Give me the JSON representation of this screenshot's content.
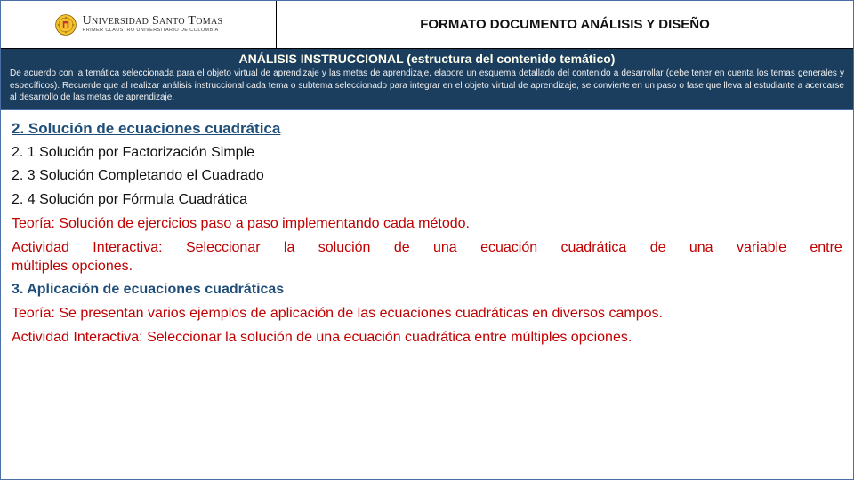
{
  "header": {
    "university_name": "Universidad Santo Tomas",
    "university_sub": "Primer claustro universitario de Colombia",
    "title": "FORMATO DOCUMENTO ANÁLISIS Y DISEÑO"
  },
  "band": {
    "title": "ANÁLISIS INSTRUCCIONAL (estructura del contenido temático)",
    "text": "De acuerdo con la temática seleccionada para el objeto virtual de aprendizaje y las metas de aprendizaje, elabore un esquema detallado del contenido a desarrollar (debe tener en cuenta los temas generales y específicos). Recuerde que al realizar análisis instruccional cada tema o subtema seleccionado para integrar en el objeto virtual de aprendizaje, se convierte en un paso o fase que lleva al estudiante a acercarse al desarrollo de las metas de aprendizaje."
  },
  "content": {
    "section2_title": "2. Solución de ecuaciones cuadrática",
    "items": {
      "a": "2. 1 Solución por Factorización Simple",
      "b": "2. 3 Solución Completando el Cuadrado",
      "c": "2. 4 Solución por Fórmula Cuadrática"
    },
    "theory2": "Teoría: Solución de ejercicios paso a paso implementando cada método.",
    "activity2_words": [
      "Actividad",
      "Interactiva:",
      "Seleccionar",
      "la",
      "solución",
      "de",
      "una",
      "ecuación",
      "cuadrática",
      "de",
      "una",
      "variable",
      "entre"
    ],
    "activity2_line2": "múltiples opciones.",
    "section3_title": "3. Aplicación de ecuaciones cuadráticas",
    "theory3": "Teoría: Se presentan varios ejemplos de aplicación de las ecuaciones cuadráticas en diversos campos.",
    "activity3": "Actividad Interactiva: Seleccionar la solución de una ecuación cuadrática entre múltiples opciones."
  }
}
